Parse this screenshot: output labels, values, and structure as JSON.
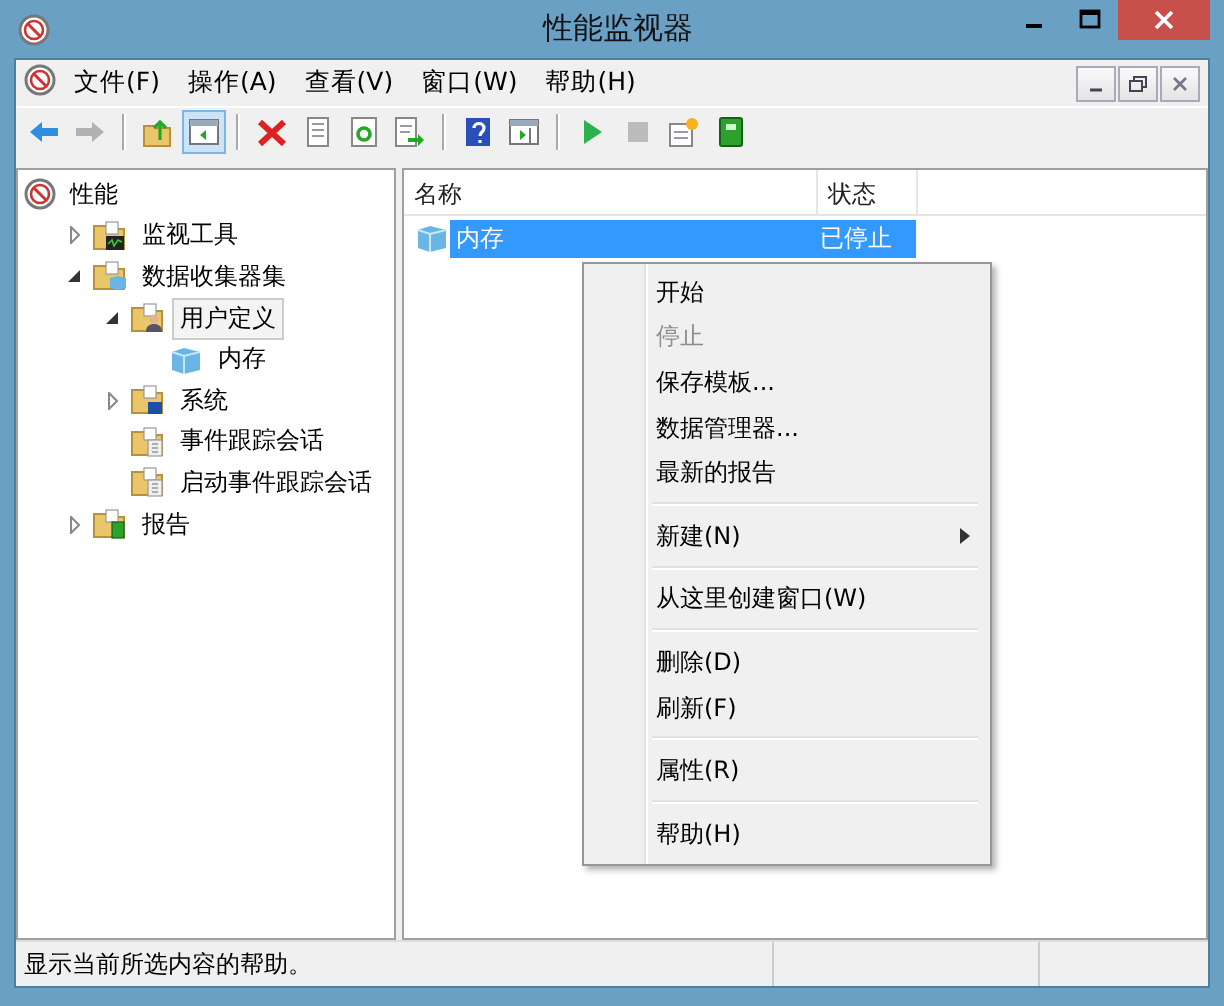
{
  "window": {
    "title": "性能监视器"
  },
  "menu_bar": [
    {
      "label": "文件(F)"
    },
    {
      "label": "操作(A)"
    },
    {
      "label": "查看(V)"
    },
    {
      "label": "窗口(W)"
    },
    {
      "label": "帮助(H)"
    }
  ],
  "toolbar": [
    {
      "kind": "back",
      "disabled": false,
      "pressed": false
    },
    {
      "kind": "forward",
      "disabled": true,
      "pressed": false
    },
    {
      "kind": "separator"
    },
    {
      "kind": "up",
      "disabled": false,
      "pressed": false
    },
    {
      "kind": "tree",
      "disabled": false,
      "pressed": true
    },
    {
      "kind": "separator"
    },
    {
      "kind": "delete",
      "disabled": false,
      "pressed": false
    },
    {
      "kind": "properties",
      "disabled": false,
      "pressed": false
    },
    {
      "kind": "refresh",
      "disabled": false,
      "pressed": false
    },
    {
      "kind": "export",
      "disabled": false,
      "pressed": false
    },
    {
      "kind": "separator"
    },
    {
      "kind": "help",
      "disabled": false,
      "pressed": false
    },
    {
      "kind": "panel",
      "disabled": false,
      "pressed": false
    },
    {
      "kind": "separator"
    },
    {
      "kind": "start",
      "disabled": false,
      "pressed": false
    },
    {
      "kind": "stop",
      "disabled": true,
      "pressed": false
    },
    {
      "kind": "new",
      "disabled": false,
      "pressed": false
    },
    {
      "kind": "book",
      "disabled": false,
      "pressed": false
    }
  ],
  "tree": [
    {
      "label": "性能",
      "kind": "gauge",
      "selected": false,
      "children": [
        {
          "label": "监视工具",
          "kind": "monitor-folder",
          "selected": false,
          "expanded": false
        },
        {
          "label": "数据收集器集",
          "kind": "collector-folder",
          "selected": false,
          "expanded": true,
          "children": [
            {
              "label": "用户定义",
              "kind": "user-folder",
              "selected": true,
              "expanded": true,
              "children": [
                {
                  "label": "内存",
                  "kind": "set",
                  "selected": false
                }
              ]
            },
            {
              "label": "系统",
              "kind": "system-folder",
              "selected": false,
              "expanded": false
            },
            {
              "label": "事件跟踪会话",
              "kind": "trace-folder",
              "selected": false
            },
            {
              "label": "启动事件跟踪会话",
              "kind": "trace-folder",
              "selected": false
            }
          ]
        },
        {
          "label": "报告",
          "kind": "report-folder",
          "selected": false,
          "expanded": false
        }
      ]
    }
  ],
  "table": {
    "columns": [
      "名称",
      "状态"
    ],
    "rows": [
      {
        "cells": [
          "内存",
          "已停止"
        ],
        "selected": true
      }
    ]
  },
  "context_menu": [
    {
      "kind": "item",
      "label": "开始",
      "disabled": false
    },
    {
      "kind": "item",
      "label": "停止",
      "disabled": true
    },
    {
      "kind": "item",
      "label": "保存模板...",
      "disabled": false
    },
    {
      "kind": "item",
      "label": "数据管理器...",
      "disabled": false
    },
    {
      "kind": "item",
      "label": "最新的报告",
      "disabled": false
    },
    {
      "kind": "separator"
    },
    {
      "kind": "submenu",
      "label": "新建(N)",
      "disabled": false
    },
    {
      "kind": "separator"
    },
    {
      "kind": "item",
      "label": "从这里创建窗口(W)",
      "disabled": false
    },
    {
      "kind": "separator"
    },
    {
      "kind": "item",
      "label": "删除(D)",
      "disabled": false
    },
    {
      "kind": "item",
      "label": "刷新(F)",
      "disabled": false
    },
    {
      "kind": "separator"
    },
    {
      "kind": "item",
      "label": "属性(R)",
      "disabled": false
    },
    {
      "kind": "separator"
    },
    {
      "kind": "item",
      "label": "帮助(H)",
      "disabled": false
    }
  ],
  "status_bar": {
    "text": "显示当前所选内容的帮助。"
  }
}
